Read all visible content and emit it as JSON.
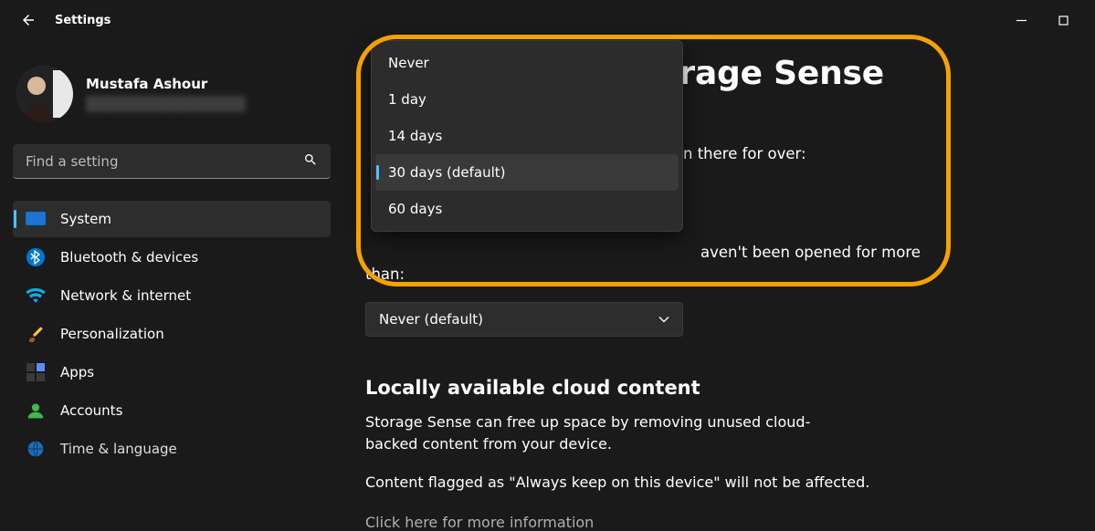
{
  "titlebar": {
    "title": "Settings"
  },
  "profile": {
    "name": "Mustafa Ashour"
  },
  "search": {
    "placeholder": "Find a setting"
  },
  "nav": {
    "items": [
      {
        "label": "System"
      },
      {
        "label": "Bluetooth & devices"
      },
      {
        "label": "Network & internet"
      },
      {
        "label": "Personalization"
      },
      {
        "label": "Apps"
      },
      {
        "label": "Accounts"
      },
      {
        "label": "Time & language"
      }
    ]
  },
  "main": {
    "title": "Storage Sense",
    "recycle_text": "n there for over:",
    "downloads_text": "aven't been opened for more than:",
    "select2_value": "Never (default)",
    "section_head": "Locally available cloud content",
    "section_body1": "Storage Sense can free up space by removing unused cloud-backed content from your device.",
    "section_body2": "Content flagged as \"Always keep on this device\" will not be affected.",
    "link": "Click here for more information"
  },
  "dropdown": {
    "options": [
      "Never",
      "1 day",
      "14 days",
      "30 days (default)",
      "60 days"
    ],
    "selected_index": 3
  }
}
